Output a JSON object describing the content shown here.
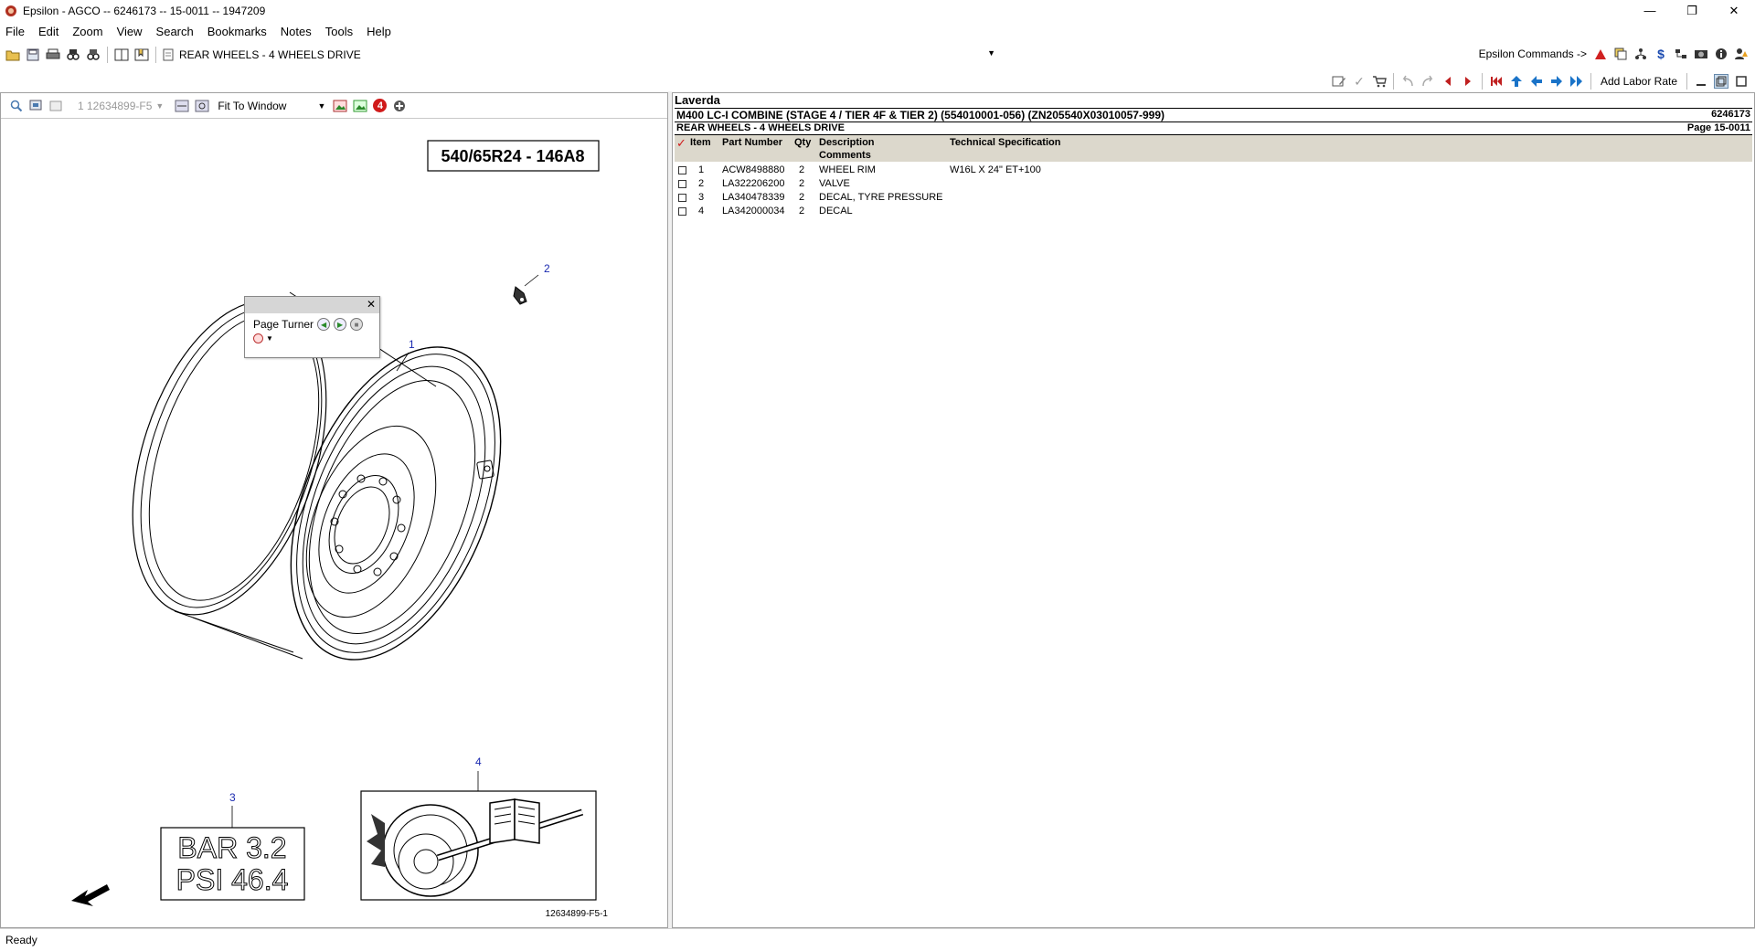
{
  "window": {
    "title": "Epsilon - AGCO -- 6246173 -- 15-0011 -- 1947209"
  },
  "menu": [
    "File",
    "Edit",
    "Zoom",
    "View",
    "Search",
    "Bookmarks",
    "Notes",
    "Tools",
    "Help"
  ],
  "toolbar": {
    "current_page": "REAR WHEELS - 4 WHEELS DRIVE",
    "epsilon_commands": "Epsilon Commands ->",
    "add_labor_rate": "Add Labor Rate"
  },
  "viewer": {
    "page_select": "1 12634899-F5",
    "zoom_mode": "Fit To Window",
    "notes_badge": "4",
    "tire_size": "540/65R24 - 146A8",
    "callouts": [
      "1",
      "2",
      "3",
      "4"
    ],
    "decal_line1": "BAR 3.2",
    "decal_line2": "PSI 46.4",
    "figure_id": "12634899-F5-1"
  },
  "page_turner": {
    "label": "Page Turner"
  },
  "parts": {
    "brand": "Laverda",
    "model": "M400 LC-I COMBINE (STAGE 4 / TIER 4F & TIER 2) (554010001-056) (ZN205540X03010057-999)",
    "catalog_no": "6246173",
    "section": "REAR WHEELS - 4 WHEELS DRIVE",
    "page": "Page 15-0011",
    "columns": {
      "item": "Item",
      "part_number": "Part Number",
      "qty": "Qty",
      "description": "Description",
      "comments": "Comments",
      "tech_spec": "Technical Specification"
    },
    "rows": [
      {
        "item": "1",
        "part_number": "ACW8498880",
        "qty": "2",
        "description": "WHEEL RIM",
        "tech_spec": "W16L X 24\" ET+100"
      },
      {
        "item": "2",
        "part_number": "LA322206200",
        "qty": "2",
        "description": "VALVE",
        "tech_spec": ""
      },
      {
        "item": "3",
        "part_number": "LA340478339",
        "qty": "2",
        "description": "DECAL, TYRE PRESSURE",
        "tech_spec": ""
      },
      {
        "item": "4",
        "part_number": "LA342000034",
        "qty": "2",
        "description": "DECAL",
        "tech_spec": ""
      }
    ]
  },
  "status": {
    "text": "Ready"
  }
}
